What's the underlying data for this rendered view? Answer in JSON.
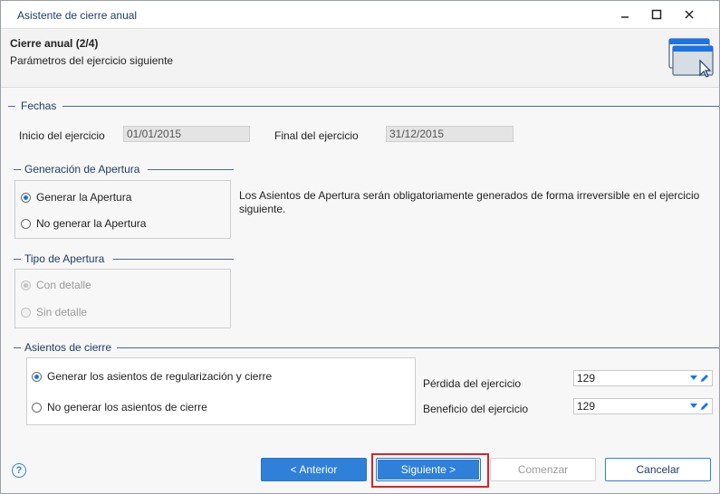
{
  "window": {
    "title": "Asistente de cierre anual",
    "controls": {
      "minimize": "minimize-icon",
      "maximize": "maximize-icon",
      "close": "close-icon"
    }
  },
  "header": {
    "title": "Cierre anual (2/4)",
    "subtitle": "Parámetros del ejercicio siguiente",
    "icon": "wizard-window-icon"
  },
  "fechas": {
    "section_label": "Fechas",
    "inicio_label": "Inicio del ejercicio",
    "inicio_value": "01/01/2015",
    "final_label": "Final del ejercicio",
    "final_value": "31/12/2015"
  },
  "generacion": {
    "section_label": "Generación de Apertura",
    "options": [
      {
        "label": "Generar la Apertura",
        "selected": true
      },
      {
        "label": "No generar la Apertura",
        "selected": false
      }
    ],
    "note": "Los Asientos de Apertura serán obligatoriamente generados de forma irreversible en el ejercicio siguiente."
  },
  "tipo": {
    "section_label": "Tipo de Apertura",
    "options": [
      {
        "label": "Con detalle",
        "selected": true,
        "disabled": true
      },
      {
        "label": "Sin detalle",
        "selected": false,
        "disabled": true
      }
    ]
  },
  "asientos": {
    "section_label": "Asientos de cierre",
    "options": [
      {
        "label": "Generar los asientos de regularización y cierre",
        "selected": true
      },
      {
        "label": "No generar los asientos de cierre",
        "selected": false
      }
    ],
    "perdida_label": "Pérdida del ejercicio",
    "perdida_value": "129",
    "beneficio_label": "Beneficio del ejercicio",
    "beneficio_value": "129"
  },
  "footer": {
    "help_icon": "help-icon",
    "help_glyph": "?",
    "anterior": "< Anterior",
    "siguiente": "Siguiente >",
    "comenzar": "Comenzar",
    "cancelar": "Cancelar"
  },
  "colors": {
    "accent": "#2f80d9",
    "highlight": "#d9232b",
    "section_line": "#4a6a96",
    "title_text": "#1f3d64"
  }
}
